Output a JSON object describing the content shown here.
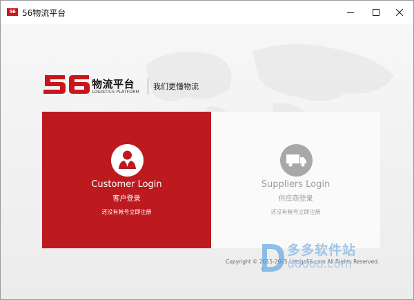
{
  "window": {
    "title": "56物流平台",
    "app_icon_text": "56",
    "controls": [
      "minimize-icon",
      "maximize-icon",
      "close-icon"
    ]
  },
  "header": {
    "logo_number": "56",
    "logo_name": "物流平台",
    "logo_subtitle": "LOGISTICS PLATFORM",
    "slogan": "我们更懂物流"
  },
  "customer_panel": {
    "title_en": "Customer Login",
    "title_cn": "客户登录",
    "register_text": "还没有帐号立即注册",
    "icon": "user-icon",
    "color": "#bd1a1f"
  },
  "supplier_panel": {
    "title_en": "Suppliers Login",
    "title_cn": "供应商登录",
    "register_text": "还没有帐号立即注册",
    "icon": "truck-icon"
  },
  "footer": {
    "copyright": "Copyright © 2015-2025 Letsgo56.com All Rights Reserved."
  },
  "watermark": {
    "name": "多多软件站",
    "url": "ddooo.com"
  }
}
